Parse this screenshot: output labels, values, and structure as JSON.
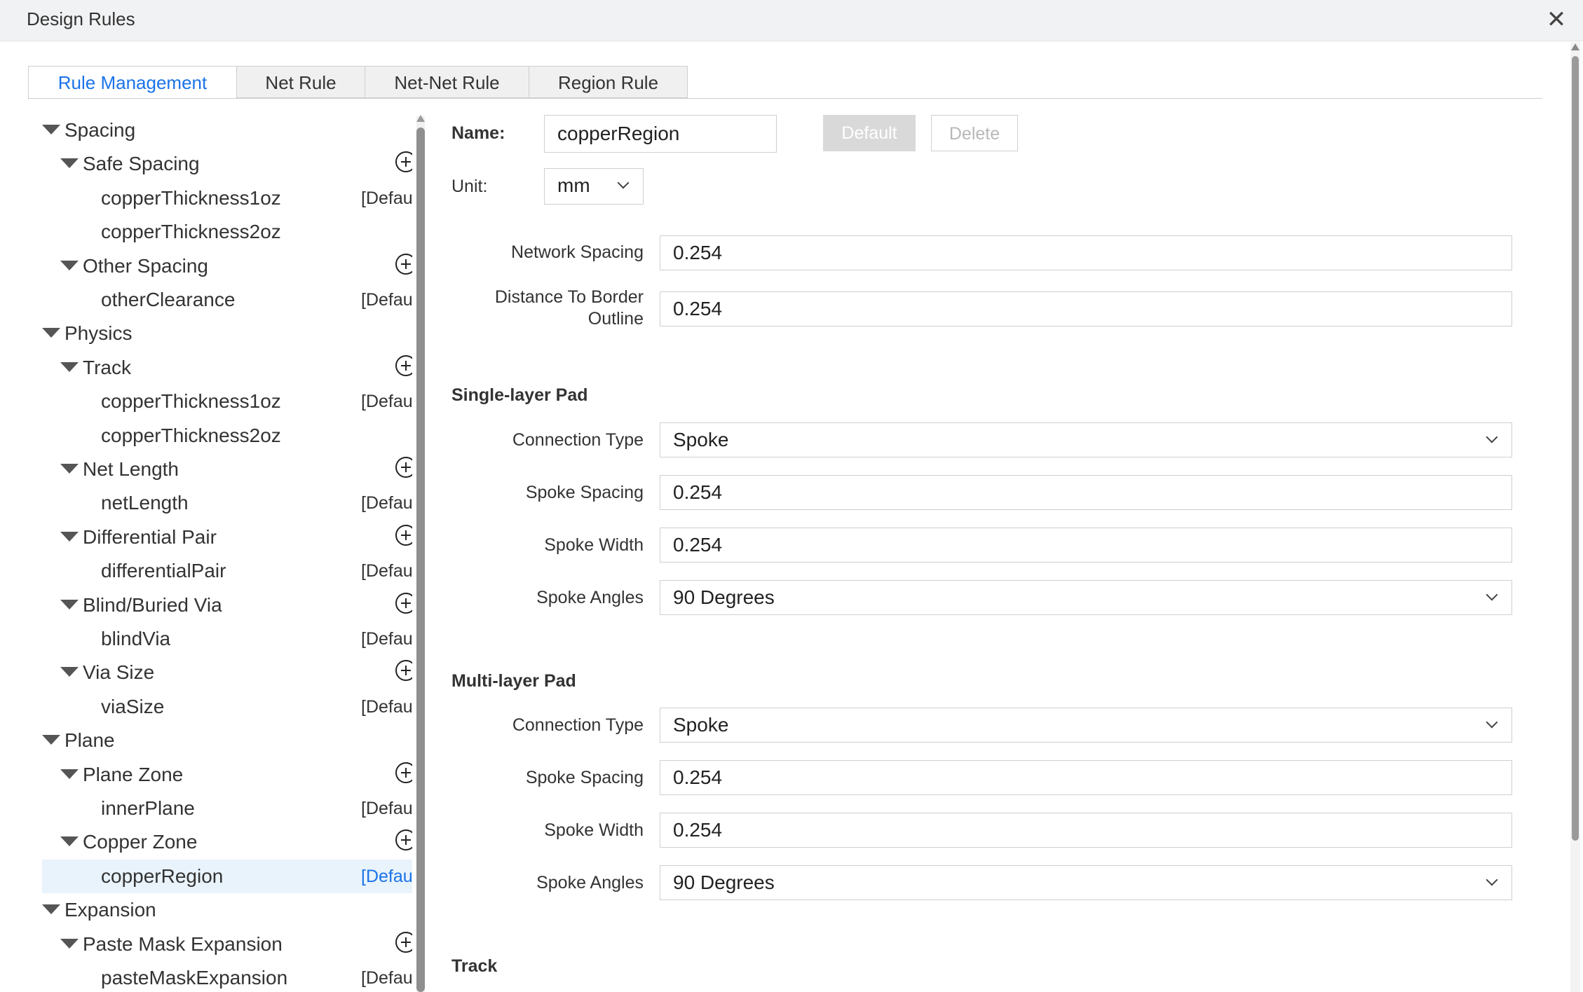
{
  "window": {
    "title": "Design Rules",
    "close_glyph": "✕"
  },
  "tabs": [
    {
      "label": "Rule Management",
      "active": true
    },
    {
      "label": "Net Rule",
      "active": false
    },
    {
      "label": "Net-Net Rule",
      "active": false
    },
    {
      "label": "Region Rule",
      "active": false
    }
  ],
  "tree": [
    {
      "label": "Spacing",
      "level": 0,
      "expanded": true
    },
    {
      "label": "Safe Spacing",
      "level": 1,
      "expanded": true,
      "add": true
    },
    {
      "label": "copperThickness1oz",
      "level": 2,
      "badge": "[Default]"
    },
    {
      "label": "copperThickness2oz",
      "level": 2
    },
    {
      "label": "Other Spacing",
      "level": 1,
      "expanded": true,
      "add": true
    },
    {
      "label": "otherClearance",
      "level": 2,
      "badge": "[Default]"
    },
    {
      "label": "Physics",
      "level": 0,
      "expanded": true
    },
    {
      "label": "Track",
      "level": 1,
      "expanded": true,
      "add": true
    },
    {
      "label": "copperThickness1oz",
      "level": 2,
      "badge": "[Default]"
    },
    {
      "label": "copperThickness2oz",
      "level": 2
    },
    {
      "label": "Net Length",
      "level": 1,
      "expanded": true,
      "add": true
    },
    {
      "label": "netLength",
      "level": 2,
      "badge": "[Default]"
    },
    {
      "label": "Differential Pair",
      "level": 1,
      "expanded": true,
      "add": true
    },
    {
      "label": "differentialPair",
      "level": 2,
      "badge": "[Default]"
    },
    {
      "label": "Blind/Buried Via",
      "level": 1,
      "expanded": true,
      "add": true
    },
    {
      "label": "blindVia",
      "level": 2,
      "badge": "[Default]"
    },
    {
      "label": "Via Size",
      "level": 1,
      "expanded": true,
      "add": true
    },
    {
      "label": "viaSize",
      "level": 2,
      "badge": "[Default]"
    },
    {
      "label": "Plane",
      "level": 0,
      "expanded": true
    },
    {
      "label": "Plane Zone",
      "level": 1,
      "expanded": true,
      "add": true
    },
    {
      "label": "innerPlane",
      "level": 2,
      "badge": "[Default]"
    },
    {
      "label": "Copper Zone",
      "level": 1,
      "expanded": true,
      "add": true
    },
    {
      "label": "copperRegion",
      "level": 2,
      "badge": "[Default]",
      "selected": true
    },
    {
      "label": "Expansion",
      "level": 0,
      "expanded": true
    },
    {
      "label": "Paste Mask Expansion",
      "level": 1,
      "expanded": true,
      "add": true
    },
    {
      "label": "pasteMaskExpansion",
      "level": 2,
      "badge": "[Default]"
    }
  ],
  "form": {
    "name_label": "Name:",
    "name_value": "copperRegion",
    "default_button": "Default",
    "delete_button": "Delete",
    "unit_label": "Unit:",
    "unit_value": "mm",
    "network_spacing_label": "Network Spacing",
    "network_spacing_value": "0.254",
    "distance_border_label_1": "Distance To Border",
    "distance_border_label_2": "Outline",
    "distance_border_value": "0.254",
    "single_layer": {
      "heading": "Single-layer Pad",
      "connection_type_label": "Connection Type",
      "connection_type_value": "Spoke",
      "spoke_spacing_label": "Spoke Spacing",
      "spoke_spacing_value": "0.254",
      "spoke_width_label": "Spoke Width",
      "spoke_width_value": "0.254",
      "spoke_angles_label": "Spoke Angles",
      "spoke_angles_value": "90 Degrees"
    },
    "multi_layer": {
      "heading": "Multi-layer Pad",
      "connection_type_label": "Connection Type",
      "connection_type_value": "Spoke",
      "spoke_spacing_label": "Spoke Spacing",
      "spoke_spacing_value": "0.254",
      "spoke_width_label": "Spoke Width",
      "spoke_width_value": "0.254",
      "spoke_angles_label": "Spoke Angles",
      "spoke_angles_value": "90 Degrees"
    },
    "track_heading": "Track"
  },
  "colors": {
    "accent": "#1a73e8",
    "selected_row": "#e9f3fc",
    "titlebar": "#f1f2f3"
  }
}
